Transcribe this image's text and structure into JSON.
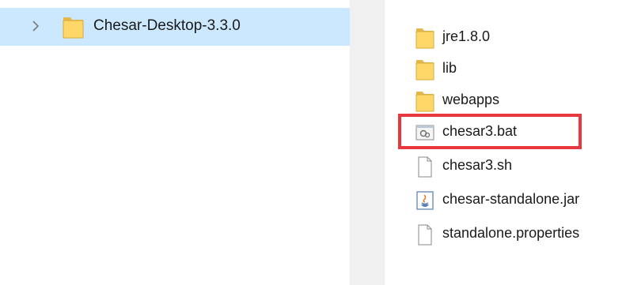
{
  "navigation": {
    "expanded_item": {
      "label": "Chesar-Desktop-3.3.0",
      "icon": "folder-icon",
      "selected": true
    }
  },
  "file_list": [
    {
      "name": "jre1.8.0",
      "type": "folder",
      "icon": "folder-icon"
    },
    {
      "name": "lib",
      "type": "folder",
      "icon": "folder-icon"
    },
    {
      "name": "webapps",
      "type": "folder",
      "icon": "folder-icon"
    },
    {
      "name": "chesar3.bat",
      "type": "batch",
      "icon": "batch-file-icon",
      "highlighted": true
    },
    {
      "name": "chesar3.sh",
      "type": "file",
      "icon": "document-icon"
    },
    {
      "name": "chesar-standalone.jar",
      "type": "jar",
      "icon": "java-jar-icon"
    },
    {
      "name": "standalone.properties",
      "type": "file",
      "icon": "document-icon"
    }
  ],
  "colors": {
    "selection": "#cce8ff",
    "folder": "#ffd769",
    "highlight": "#e8383d"
  }
}
